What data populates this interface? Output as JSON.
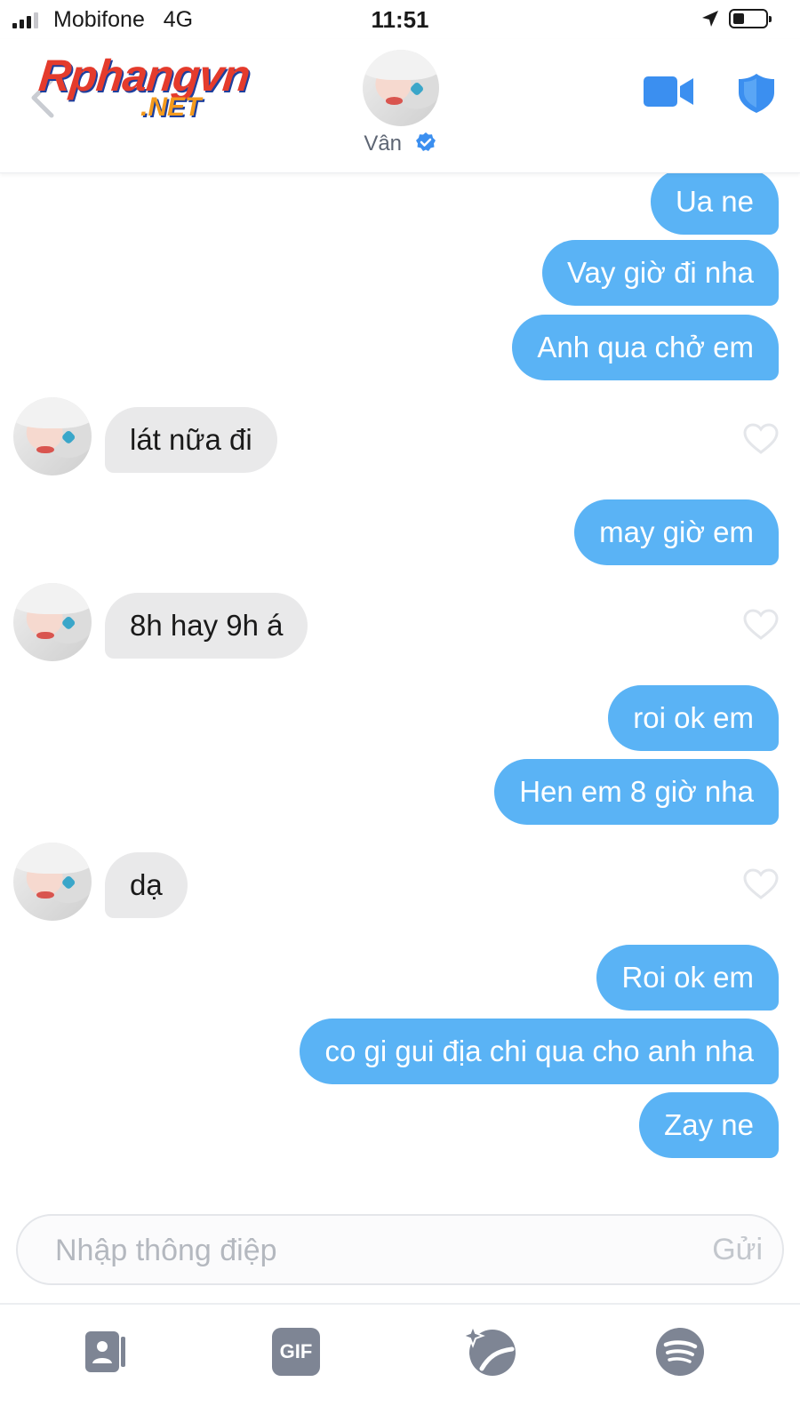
{
  "status_bar": {
    "carrier": "Mobifone",
    "network": "4G",
    "time": "11:51",
    "battery_level": 0.35
  },
  "header": {
    "watermark_line1": "Rphangvn",
    "watermark_line2": ".NET",
    "contact_name": "Vân",
    "icons": [
      "back-icon",
      "video-call-icon",
      "safety-shield-icon",
      "verified-badge-icon"
    ]
  },
  "messages": [
    {
      "direction": "out",
      "text": "Ua ne"
    },
    {
      "direction": "out",
      "text": "Vay giờ đi nha"
    },
    {
      "direction": "out",
      "text": "Anh qua chở em"
    },
    {
      "direction": "in",
      "text": "lát nữa đi"
    },
    {
      "direction": "out",
      "text": "may giờ em"
    },
    {
      "direction": "in",
      "text": "8h hay 9h á"
    },
    {
      "direction": "out",
      "text": "roi ok em"
    },
    {
      "direction": "out",
      "text": "Hen em 8 giờ nha"
    },
    {
      "direction": "in",
      "text": "dạ"
    },
    {
      "direction": "out",
      "text": "Roi ok em"
    },
    {
      "direction": "out",
      "text": "co gi gui địa chi qua cho anh nha"
    },
    {
      "direction": "out",
      "text": "Zay ne"
    }
  ],
  "composer": {
    "placeholder": "Nhập thông điệp",
    "value": "",
    "send_label": "Gửi"
  },
  "toolbar": {
    "gif_label": "GIF",
    "icons": [
      "contact-card-icon",
      "gif-icon",
      "spark-sticker-icon",
      "spotify-icon"
    ]
  },
  "colors": {
    "outgoing_bubble": "#5ab3f5",
    "incoming_bubble": "#e9e9ea",
    "verified_badge": "#3b8ff0",
    "icon_blue": "#3b8ff0"
  }
}
